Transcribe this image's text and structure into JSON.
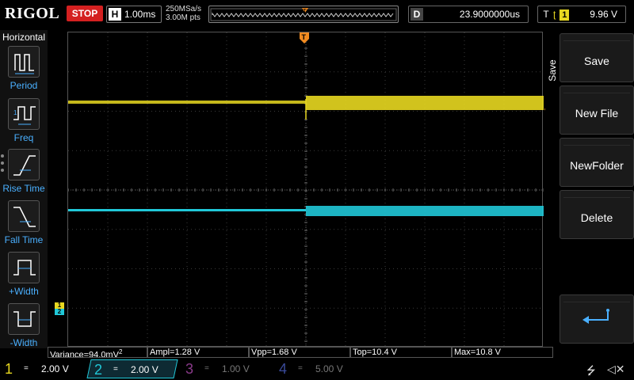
{
  "brand": "RIGOL",
  "run_state": "STOP",
  "horizontal": {
    "key": "H",
    "timebase": "1.00ms"
  },
  "sample": {
    "rate": "250MSa/s",
    "depth": "3.00M pts"
  },
  "delay": {
    "key": "D",
    "value": "23.9000000us"
  },
  "trigger": {
    "key": "T",
    "source": "1",
    "level": "9.96 V"
  },
  "left_menu": {
    "title": "Horizontal",
    "items": [
      {
        "label": "Period",
        "icon": "period-icon"
      },
      {
        "label": "Freq",
        "icon": "frequency-icon"
      },
      {
        "label": "Rise Time",
        "icon": "rise-time-icon"
      },
      {
        "label": "Fall Time",
        "icon": "fall-time-icon"
      },
      {
        "label": "+Width",
        "icon": "positive-width-icon"
      },
      {
        "label": "-Width",
        "icon": "negative-width-icon"
      }
    ]
  },
  "right_menu": {
    "tab": "Save",
    "keys": [
      {
        "label": "Save"
      },
      {
        "label": "New File"
      },
      {
        "label": "NewFolder"
      },
      {
        "label": "Delete"
      }
    ],
    "back_icon": "return-arrow-icon"
  },
  "measurements": {
    "variance_label": "Variance=94.0mV",
    "variance_sup": "2",
    "ampl": "Ampl=1.28 V",
    "vpp": "Vpp=1.68 V",
    "top": "Top=10.4 V",
    "max": "Max=10.8 V"
  },
  "channels": [
    {
      "num": "1",
      "coupling": "=",
      "scale": "2.00 V",
      "color": "#e8d820"
    },
    {
      "num": "2",
      "coupling": "=",
      "scale": "2.00 V",
      "color": "#20c8d8"
    },
    {
      "num": "3",
      "coupling": "=",
      "scale": "1.00 V",
      "color": "#8a3a8a"
    },
    {
      "num": "4",
      "coupling": "=",
      "scale": "5.00 V",
      "color": "#3a4a9a"
    }
  ],
  "markers": {
    "trigger_pos": "T",
    "ch_ground_1": "1",
    "ch_ground_2": "2"
  },
  "status_icons": [
    "usb-icon",
    "speaker-muted-icon"
  ]
}
